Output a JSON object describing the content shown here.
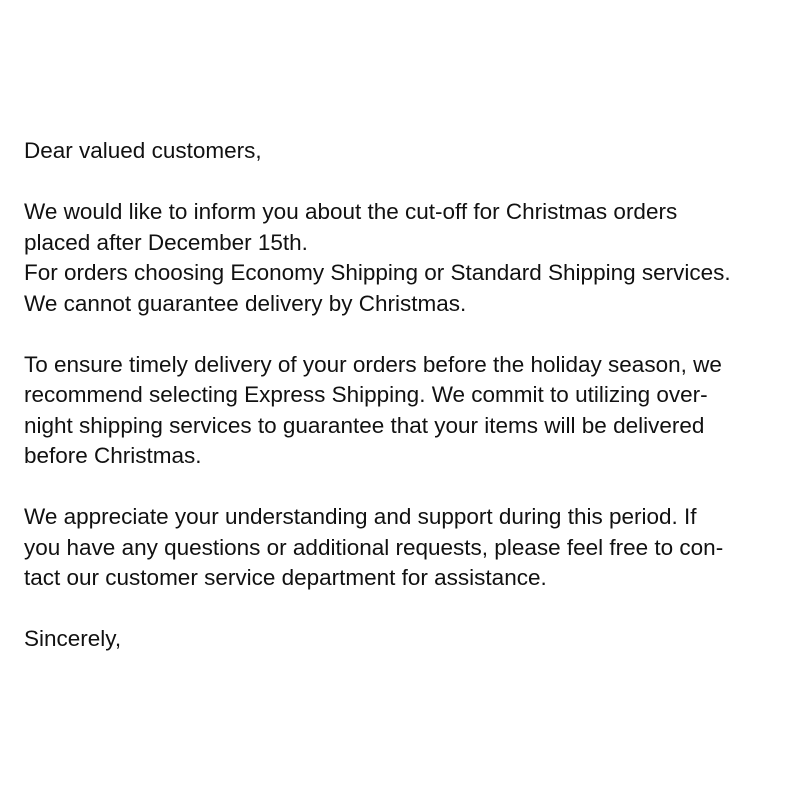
{
  "letter": {
    "greeting": "Dear valued customers,",
    "paragraph1": [
      "We would like to inform you about the cut-off for Christmas orders",
      "placed after December 15th.",
      "For orders choosing Economy Shipping or Standard Shipping services.",
      "We cannot guarantee delivery by Christmas."
    ],
    "paragraph2": [
      "To ensure timely delivery of your orders before the holiday season, we",
      "recommend selecting Express Shipping. We commit to utilizing over-",
      "night shipping services to guarantee that your items will be delivered",
      "before Christmas."
    ],
    "paragraph3": [
      "We appreciate your understanding and support during this period. If",
      "you have any questions or additional requests, please feel free to con-",
      "tact our customer service department for assistance."
    ],
    "closing": "Sincerely,"
  }
}
